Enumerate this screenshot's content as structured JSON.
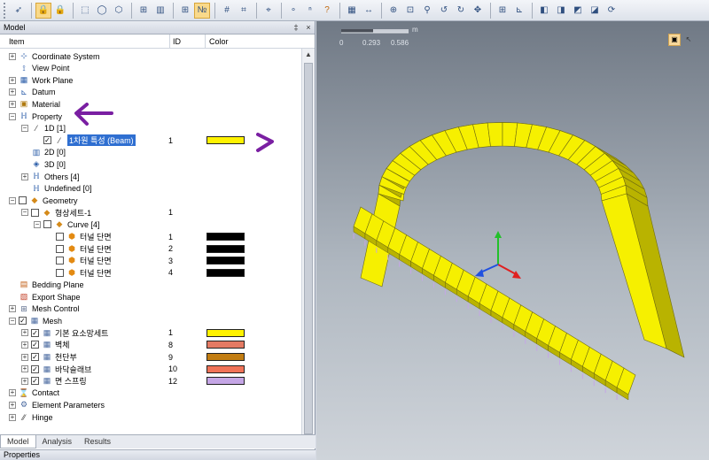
{
  "toolbar": {
    "icons": [
      "pointer-icon",
      "lock-icon",
      "lock-icon",
      "select-icon",
      "circle-select-icon",
      "polygon-select-icon",
      "filter-icon",
      "hide-icon",
      "show-icon",
      "number-icon",
      "grid-icon",
      "snap-icon",
      "coordinate-icon",
      "node-icon",
      "node-number-icon",
      "query-icon",
      "table-icon",
      "distance-icon",
      "zoom-window-icon",
      "zoom-fit-icon",
      "zoom-icon",
      "rotate-left-icon",
      "rotate-right-icon",
      "pan-icon",
      "view-icon",
      "axis-icon",
      "front-view-icon",
      "top-view-icon",
      "side-view-icon",
      "iso-view-icon",
      "refresh-icon"
    ]
  },
  "panel": {
    "title": "Model",
    "pin": "‡",
    "close": "×",
    "columns": {
      "item": "Item",
      "id": "ID",
      "color": "Color"
    }
  },
  "tree": {
    "coordinate_system": "Coordinate System",
    "view_point": "View Point",
    "work_plane": "Work Plane",
    "datum": "Datum",
    "material": "Material",
    "property": "Property",
    "prop_1d": "1D [1]",
    "beam_property": "1차원 특성 (Beam)",
    "beam_property_id": "1",
    "prop_2d": "2D [0]",
    "prop_3d": "3D [0]",
    "prop_others": "Others [4]",
    "prop_undefined": "Undefined [0]",
    "geometry": "Geometry",
    "geometry_set": "형상세트-1",
    "geometry_set_id": "1",
    "curve": "Curve [4]",
    "curves": [
      {
        "label": "터널 단면",
        "id": "1"
      },
      {
        "label": "터널 단면",
        "id": "2"
      },
      {
        "label": "터널 단면",
        "id": "3"
      },
      {
        "label": "터널 단면",
        "id": "4"
      }
    ],
    "bedding_plane": "Bedding Plane",
    "export_shape": "Export Shape",
    "mesh_control": "Mesh Control",
    "mesh": "Mesh",
    "mesh_sets": [
      {
        "label": "기본 요소망세트",
        "id": "1",
        "color": "#fff200"
      },
      {
        "label": "벽체",
        "id": "8",
        "color": "#e47a63"
      },
      {
        "label": "천단부",
        "id": "9",
        "color": "#c27d12"
      },
      {
        "label": "바닥슬래브",
        "id": "10",
        "color": "#f07358"
      },
      {
        "label": "면 스프링",
        "id": "12",
        "color": "#c5a6e6"
      }
    ],
    "contact": "Contact",
    "element_parameters": "Element Parameters",
    "hinge": "Hinge"
  },
  "colors": {
    "beam": "#fff200",
    "curve": "#000000",
    "selection": "#2f6fd1",
    "annotation": "#7a1fa2",
    "mesh_yellow": "#f6f000",
    "mesh_shade": "#b9b300"
  },
  "tabs": [
    "Model",
    "Analysis",
    "Results"
  ],
  "properties_title": "Properties",
  "viewport": {
    "scale_unit": "m",
    "scale_ticks": [
      "0",
      "0.293",
      "0.586"
    ]
  }
}
